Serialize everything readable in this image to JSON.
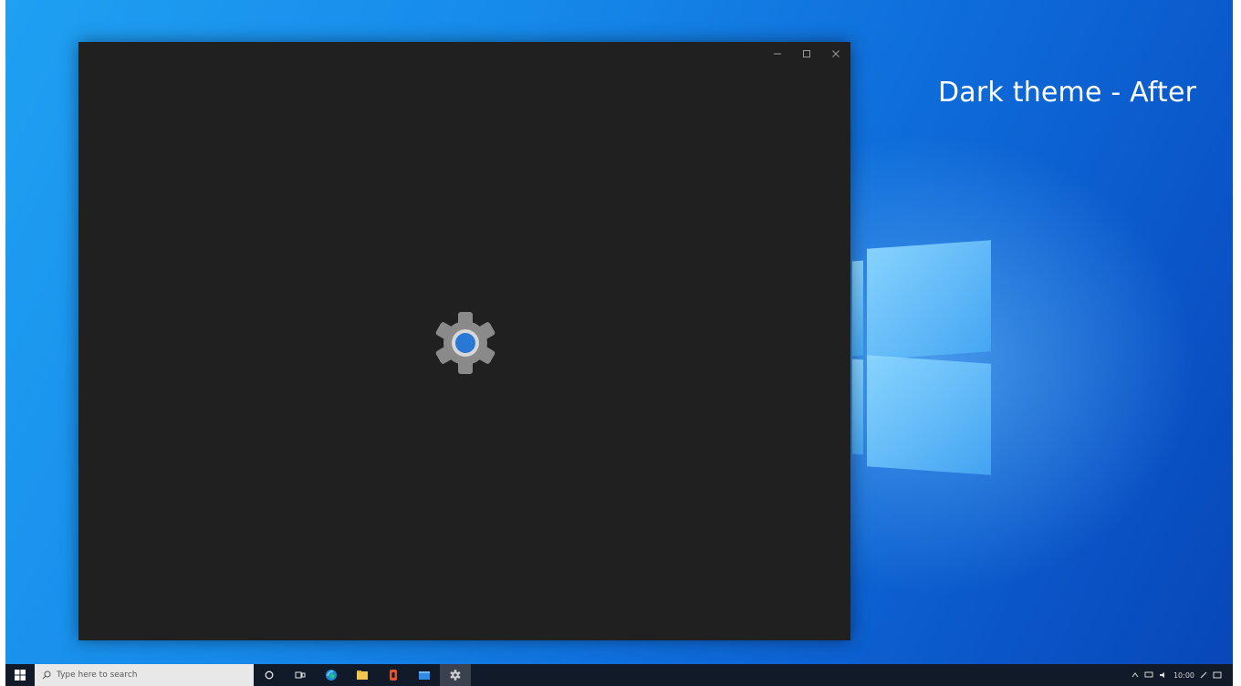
{
  "desktop": {
    "caption": "Dark theme - After"
  },
  "window": {
    "controls": {
      "minimize_icon": "minimize-icon",
      "maximize_icon": "maximize-icon",
      "close_icon": "close-icon"
    },
    "splash_icon": "settings-gear-icon",
    "background_color": "#202020",
    "accent_color": "#2a78d6"
  },
  "taskbar": {
    "search_placeholder": "Type here to search",
    "icons": [
      "windows-start-icon",
      "search-icon",
      "cortana-icon",
      "task-view-icon",
      "edge-icon",
      "file-explorer-icon",
      "office-icon",
      "mail-icon",
      "settings-icon"
    ],
    "tray_time": "10:00"
  }
}
